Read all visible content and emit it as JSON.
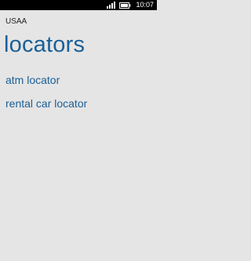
{
  "status_bar": {
    "time": "10:07",
    "icons": [
      "signal-icon",
      "battery-icon"
    ]
  },
  "header": {
    "app_name": "USAA",
    "page_title": "locators"
  },
  "menu": {
    "items": [
      {
        "label": "atm locator"
      },
      {
        "label": "rental car locator"
      }
    ]
  },
  "colors": {
    "accent": "#1a5f97",
    "background": "#e5e5e5",
    "status_bar": "#000000"
  }
}
